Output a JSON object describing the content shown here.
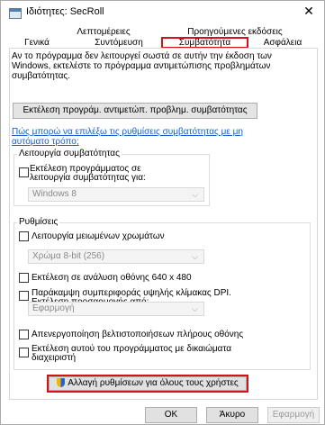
{
  "window": {
    "title": "Ιδιότητες: SecRoll",
    "close_glyph": "✕"
  },
  "tabs_row1": [
    "Λεπτομέρειες",
    "Προηγούμενες εκδόσεις"
  ],
  "tabs_row2": [
    "Γενικά",
    "Συντόμευση",
    "Συμβατότητα",
    "Ασφάλεια"
  ],
  "active_tab": "Συμβατότητα",
  "intro_text": "Αν το πρόγραμμα δεν λειτουργεί σωστά σε αυτήν την έκδοση των Windows, εκτελέστε το πρόγραμμα αντιμετώπισης προβλημάτων συμβατότητας.",
  "troubleshooter_button": "Εκτέλεση προγράμ. αντιμετώπ. προβλημ. συμβατότητας",
  "manual_link": "Πώς μπορώ να επιλέξω τις ρυθμίσεις συμβατότητας με μη αυτόματο τρόπο;",
  "compat_mode": {
    "group_label": "Λειτουργία συμβατότητας",
    "checkbox_label": "Εκτέλεση προγράμματος σε λειτουργία συμβατότητας για:",
    "checked": false,
    "dropdown_value": "Windows 8"
  },
  "settings": {
    "group_label": "Ρυθμίσεις",
    "reduced_color": {
      "label": "Λειτουργία μειωμένων χρωμάτων",
      "checked": false
    },
    "color_dropdown": "Χρώμα 8-bit (256)",
    "res_640": {
      "label": "Εκτέλεση σε ανάλυση οθόνης 640 x 480",
      "checked": false
    },
    "dpi": {
      "label": "Παράκαμψη συμπεριφοράς υψηλής κλίμακας DPI. Εκτέλεση προσαρμογής από:",
      "checked": false
    },
    "dpi_dropdown": "Εφαρμογή",
    "fullscreen_opt": {
      "label": "Απενεργοποίηση βελτιστοποιήσεων πλήρους οθόνης",
      "checked": false
    },
    "admin": {
      "label": "Εκτέλεση αυτού του προγράμματος με δικαιώματα διαχειριστή",
      "checked": false
    }
  },
  "all_users_button": "Αλλαγή ρυθμίσεων για όλους τους χρήστες",
  "buttons": {
    "ok": "OK",
    "cancel": "Άκυρο",
    "apply": "Εφαρμογή"
  },
  "colors": {
    "highlight_red": "#d0141c",
    "link_blue": "#1a5bd1"
  }
}
